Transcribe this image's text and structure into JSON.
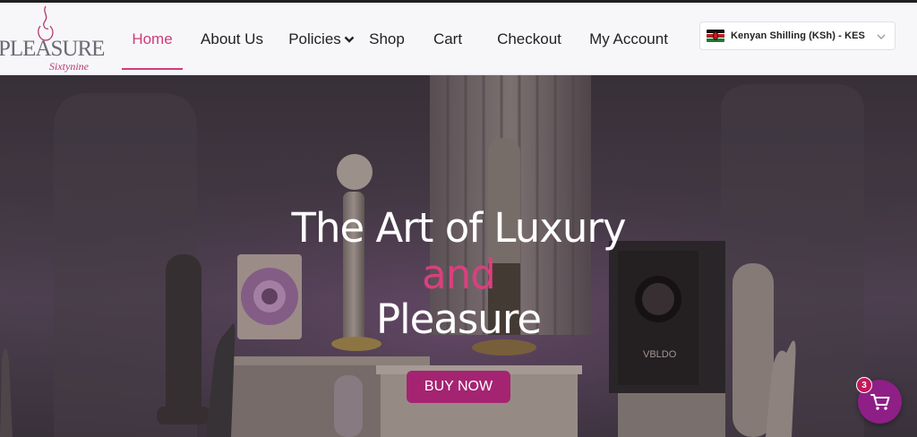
{
  "logo": {
    "main": "PLEASURE",
    "sub": "Sixtynine"
  },
  "nav": {
    "items": [
      {
        "label": "Home",
        "active": true
      },
      {
        "label": "About Us"
      },
      {
        "label": "Policies",
        "has_dropdown": true
      },
      {
        "label": "Shop"
      },
      {
        "label": "Cart"
      },
      {
        "label": "Checkout"
      },
      {
        "label": "My Account"
      }
    ]
  },
  "currency": {
    "label": "Kenyan Shilling (KSh) - KES",
    "flag": "kenya-flag"
  },
  "hero": {
    "line1": "The Art of Luxury",
    "line2": "and",
    "line3": "Pleasure",
    "button": "BUY NOW",
    "product_box_brand": "VBLDO"
  },
  "cart": {
    "count": "3",
    "icon": "cart-icon"
  },
  "colors": {
    "accent": "#d23a7a",
    "button": "#a52472",
    "cart_fab": "#8e1f86"
  }
}
